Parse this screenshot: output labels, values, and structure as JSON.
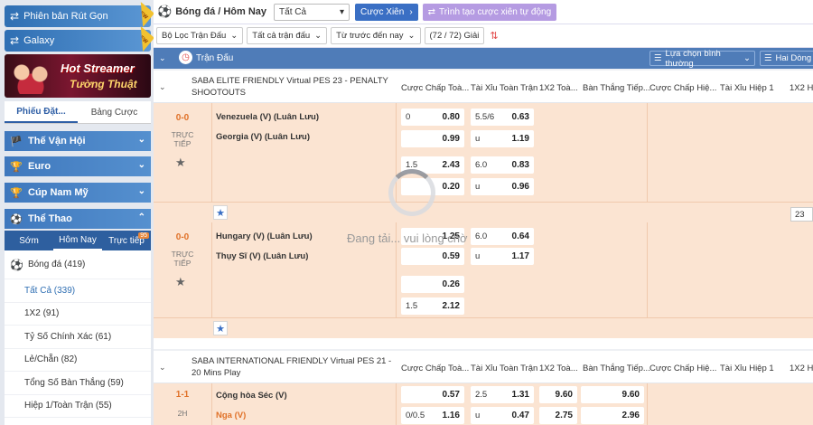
{
  "sidebar": {
    "promo1": "Phiên bản Rút Gọn",
    "promo2": "Galaxy",
    "new_badge": "NEW",
    "banner": {
      "line1": "Hot Streamer",
      "line2": "Tường Thuật"
    },
    "tabs": [
      "Phiếu Đặt...",
      "Bảng Cược"
    ],
    "sections": [
      "Thế Vận Hội",
      "Euro",
      "Cúp Nam Mỹ",
      "Thể Thao"
    ],
    "sport_tabs": {
      "early": "Sớm",
      "today": "Hôm Nay",
      "live": "Trực tiếp",
      "live_count": "95"
    },
    "sport": "Bóng đá (419)",
    "menu": [
      "Tất Cả (339)",
      "1X2 (91)",
      "Tỷ Số Chính Xác (61)",
      "Lẻ/Chẵn (82)",
      "Tổng Số Bàn Thắng (59)",
      "Hiệp 1/Toàn Trận (55)"
    ]
  },
  "topbar": {
    "title": "Bóng đá / Hôm Nay",
    "select_value": "Tất Cả",
    "parlay_button": "Cược Xiên",
    "auto_button": "Trình tạo cược xiên tự động"
  },
  "filters": {
    "league_filter": "Bộ Lọc Trận Đấu",
    "all_matches": "Tất cả trận đấu",
    "time_filter": "Từ trước đến nay",
    "count": "(72 / 72) Giải"
  },
  "table_header": {
    "match_col": "Trận Đấu",
    "view_option": "Lựa chọn bình thường",
    "odds_format": "Hai Dòng"
  },
  "market_headers": [
    "Cược Chấp Toà...",
    "Tài Xỉu Toàn Trận",
    "1X2 Toà...",
    "Bàn Thắng Tiếp...",
    "Cược Chấp Hiệ...",
    "Tài Xỉu Hiệp 1",
    "1X2 H"
  ],
  "league1": {
    "name": "SABA ELITE FRIENDLY Virtual PES 23 - PENALTY SHOOTOUTS",
    "matches": [
      {
        "score": "0-0",
        "status": "TRỰC TIẾP",
        "home": "Venezuela (V) (Luân Lưu)",
        "away": "Georgia (V) (Luân Lưu)",
        "lines": [
          {
            "hdp_h": "0",
            "hdp_home": "0.80",
            "ou_h": "5.5/6",
            "ou_over": "0.63"
          },
          {
            "hdp_h": "",
            "hdp_away": "0.99",
            "ou_h": "u",
            "ou_under": "1.19"
          },
          {
            "hdp_h": "1.5",
            "hdp_home": "2.43",
            "ou_h": "6.0",
            "ou_over": "0.83"
          },
          {
            "hdp_h": "",
            "hdp_away": "0.20",
            "ou_h": "u",
            "ou_under": "0.96"
          }
        ]
      },
      {
        "score": "0-0",
        "status": "TRỰC TIẾP",
        "home": "Hungary (V) (Luân Lưu)",
        "away": "Thụy Sĩ (V) (Luân Lưu)",
        "lines": [
          {
            "hdp_h": "",
            "hdp_home": "1.25",
            "ou_h": "6.0",
            "ou_over": "0.64"
          },
          {
            "hdp_h": "",
            "hdp_away": "0.59",
            "ou_h": "u",
            "ou_under": "1.17"
          },
          {
            "hdp_h": "",
            "hdp_home": "0.26"
          },
          {
            "hdp_h": "1.5",
            "hdp_away": "2.12"
          }
        ]
      }
    ]
  },
  "league2": {
    "name": "SABA INTERNATIONAL FRIENDLY Virtual PES 21 - 20 Mins Play",
    "match": {
      "score": "1-1",
      "status": "2H",
      "home": "Cộng hòa Séc (V)",
      "away": "Nga (V)",
      "row1": {
        "hdp_home": "0.57",
        "ou_h": "2.5",
        "ou_over": "1.31",
        "x12": "9.60",
        "next": "9.60"
      },
      "row2": {
        "hdp_h": "0/0.5",
        "hdp_away": "1.16",
        "ou_h": "u",
        "ou_under": "0.47",
        "x12": "2.75",
        "next": "2.96"
      }
    }
  },
  "pager": "23",
  "loading": "Đang tải... vui lòng chờ",
  "colors": {
    "accent": "#4f7cb8",
    "live_row": "#fbe4d2",
    "score": "#e07128"
  }
}
